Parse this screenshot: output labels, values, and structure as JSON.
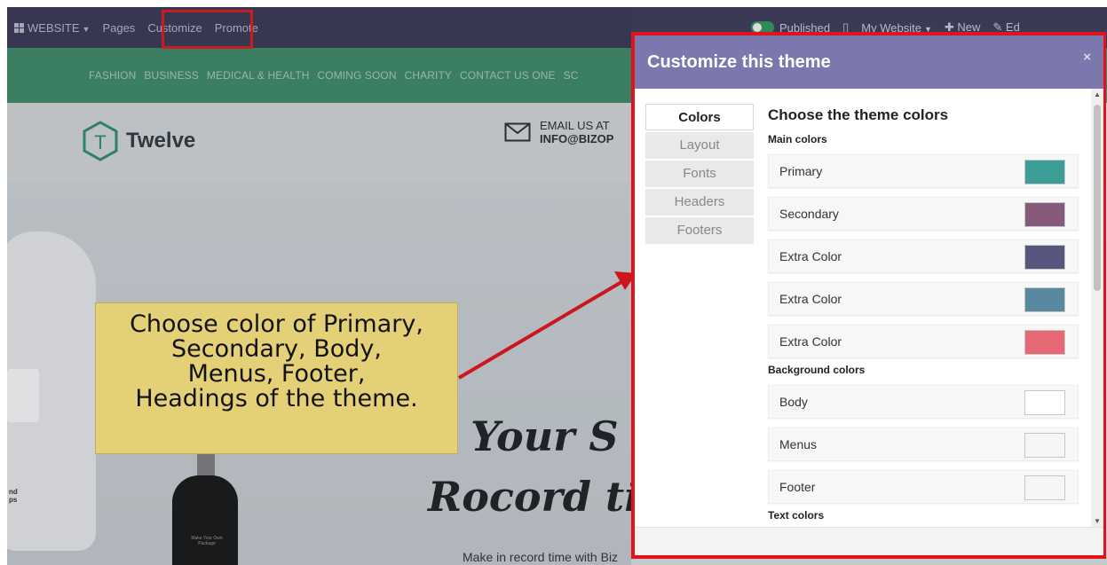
{
  "topbar": {
    "website_label": "WEBSITE",
    "pages_label": "Pages",
    "customize_label": "Customize",
    "promote_label": "Promote",
    "published_label": "Published",
    "my_website_label": "My Website",
    "new_label": "New",
    "edit_label": "Ed"
  },
  "navbar": {
    "items": [
      "FASHION",
      "BUSINESS",
      "MEDICAL & HEALTH",
      "COMING SOON",
      "CHARITY",
      "CONTACT US ONE",
      "SC"
    ]
  },
  "header": {
    "logo_letter": "T",
    "logo_text": "Twelve",
    "email_line1": "EMAIL US AT",
    "email_line2": "INFO@BIZOP"
  },
  "hero": {
    "script_line1": "d Your S",
    "script_line2": "Rocord ti",
    "subtext": "Make in record time with Biz",
    "side_text_line1": "nd",
    "side_text_line2": "ps",
    "grinder_label": "Make Your Own Package"
  },
  "callout": {
    "lines": [
      "Choose color of Primary,",
      "Secondary, Body,",
      "Menus, Footer,",
      "Headings of the theme."
    ]
  },
  "dialog": {
    "title": "Customize this theme",
    "close": "×",
    "tabs": [
      "Colors",
      "Layout",
      "Fonts",
      "Headers",
      "Footers"
    ],
    "heading": "Choose the theme colors",
    "main_colors_label": "Main colors",
    "main_colors": [
      {
        "label": "Primary",
        "color": "#3d9e98"
      },
      {
        "label": "Secondary",
        "color": "#875a7b"
      },
      {
        "label": "Extra Color",
        "color": "#58557e"
      },
      {
        "label": "Extra Color",
        "color": "#5889a0"
      },
      {
        "label": "Extra Color",
        "color": "#e66875"
      }
    ],
    "background_colors_label": "Background colors",
    "background_colors": [
      {
        "label": "Body",
        "color": "#ffffff"
      },
      {
        "label": "Menus",
        "color": "#f6f6f6"
      },
      {
        "label": "Footer",
        "color": "#f6f6f6"
      }
    ],
    "text_colors_label": "Text colors"
  },
  "colors": {
    "highlight": "#e3131b",
    "dialog_header": "#7b78ae",
    "callout_bg": "#fee77f"
  }
}
